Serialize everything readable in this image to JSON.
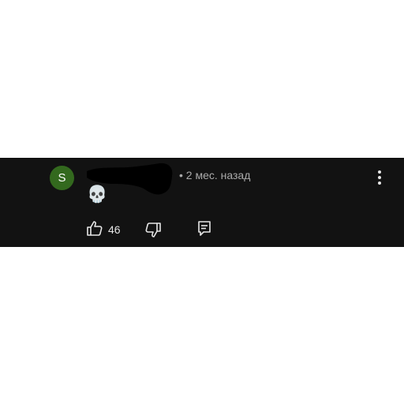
{
  "comment": {
    "avatar_letter": "S",
    "meta": "• 2 мес. назад",
    "text": "💀",
    "like_count": "46"
  },
  "colors": {
    "background": "#121212",
    "avatar_bg": "#33691e",
    "muted_text": "#aaaaaa",
    "icon": "#e6e6e6"
  },
  "icons": {
    "like": "thumb-up-icon",
    "dislike": "thumb-down-icon",
    "reply": "reply-comment-icon",
    "more": "more-vertical-icon"
  }
}
